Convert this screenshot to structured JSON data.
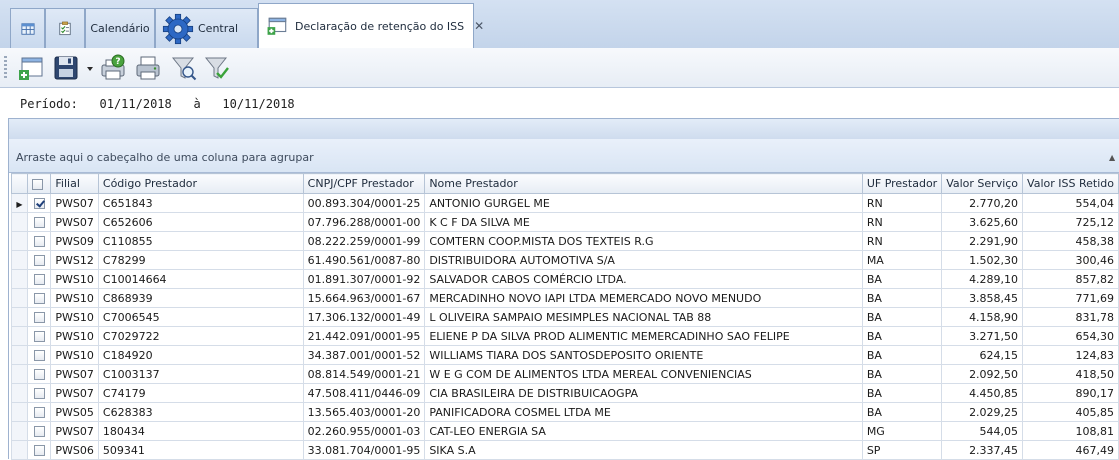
{
  "tabs": [
    {
      "label": "",
      "icon": "grid-icon"
    },
    {
      "label": "",
      "icon": "checklist-icon"
    },
    {
      "label": "Calendário",
      "icon": ""
    },
    {
      "label": "Central",
      "icon": "gear-icon"
    },
    {
      "label": "Declaração de retenção do ISS",
      "icon": "add-document-icon",
      "close": "✕"
    }
  ],
  "toolbar": {
    "icons": [
      "new-document-icon",
      "save-icon",
      "print-preview-icon",
      "print-icon",
      "filter-search-icon",
      "filter-apply-icon"
    ]
  },
  "period": {
    "label": "Período:",
    "start": "01/11/2018",
    "sep": "à",
    "end": "10/11/2018"
  },
  "grid": {
    "group_hint": "Arraste aqui o cabeçalho de uma coluna para agrupar",
    "columns": [
      "Filial",
      "Código Prestador",
      "CNPJ/CPF Prestador",
      "Nome Prestador",
      "UF Prestador",
      "Valor Serviço",
      "Valor ISS Retido"
    ],
    "rows": [
      {
        "filial": "PWS07",
        "codigo": "C651843",
        "cnpj": "00.893.304/0001-25",
        "nome": "ANTONIO GURGEL ME",
        "uf": "RN",
        "valor": "2.770,20",
        "iss": "554,04",
        "checked": true,
        "current": true
      },
      {
        "filial": "PWS07",
        "codigo": "C652606",
        "cnpj": "07.796.288/0001-00",
        "nome": "K C F DA SILVA ME",
        "uf": "RN",
        "valor": "3.625,60",
        "iss": "725,12",
        "checked": false,
        "current": false
      },
      {
        "filial": "PWS09",
        "codigo": "C110855",
        "cnpj": "08.222.259/0001-99",
        "nome": "COMTERN COOP.MISTA DOS TEXTEIS R.G",
        "uf": "RN",
        "valor": "2.291,90",
        "iss": "458,38",
        "checked": false,
        "current": false
      },
      {
        "filial": "PWS12",
        "codigo": "C78299",
        "cnpj": "61.490.561/0087-80",
        "nome": "DISTRIBUIDORA AUTOMOTIVA S/A",
        "uf": "MA",
        "valor": "1.502,30",
        "iss": "300,46",
        "checked": false,
        "current": false
      },
      {
        "filial": "PWS10",
        "codigo": "C10014664",
        "cnpj": "01.891.307/0001-92",
        "nome": "SALVADOR CABOS COMÉRCIO LTDA.",
        "uf": "BA",
        "valor": "4.289,10",
        "iss": "857,82",
        "checked": false,
        "current": false
      },
      {
        "filial": "PWS10",
        "codigo": "C868939",
        "cnpj": "15.664.963/0001-67",
        "nome": "MERCADINHO NOVO IAPI LTDA MEMERCADO NOVO MENUDO",
        "uf": "BA",
        "valor": "3.858,45",
        "iss": "771,69",
        "checked": false,
        "current": false
      },
      {
        "filial": "PWS10",
        "codigo": "C7006545",
        "cnpj": "17.306.132/0001-49",
        "nome": "L OLIVEIRA SAMPAIO MESIMPLES NACIONAL TAB 88",
        "uf": "BA",
        "valor": "4.158,90",
        "iss": "831,78",
        "checked": false,
        "current": false
      },
      {
        "filial": "PWS10",
        "codigo": "C7029722",
        "cnpj": "21.442.091/0001-95",
        "nome": "ELIENE P DA SILVA PROD ALIMENTIC MEMERCADINHO SAO FELIPE",
        "uf": "BA",
        "valor": "3.271,50",
        "iss": "654,30",
        "checked": false,
        "current": false
      },
      {
        "filial": "PWS10",
        "codigo": "C184920",
        "cnpj": "34.387.001/0001-52",
        "nome": "WILLIAMS TIARA DOS SANTOSDEPOSITO ORIENTE",
        "uf": "BA",
        "valor": "624,15",
        "iss": "124,83",
        "checked": false,
        "current": false
      },
      {
        "filial": "PWS07",
        "codigo": "C1003137",
        "cnpj": "08.814.549/0001-21",
        "nome": "W E G COM DE ALIMENTOS LTDA MEREAL CONVENIENCIAS",
        "uf": "BA",
        "valor": "2.092,50",
        "iss": "418,50",
        "checked": false,
        "current": false
      },
      {
        "filial": "PWS07",
        "codigo": "C74179",
        "cnpj": "47.508.411/0446-09",
        "nome": "CIA BRASILEIRA DE DISTRIBUICAOGPA",
        "uf": "BA",
        "valor": "4.450,85",
        "iss": "890,17",
        "checked": false,
        "current": false
      },
      {
        "filial": "PWS05",
        "codigo": "C628383",
        "cnpj": "13.565.403/0001-20",
        "nome": "PANIFICADORA COSMEL LTDA ME",
        "uf": "BA",
        "valor": "2.029,25",
        "iss": "405,85",
        "checked": false,
        "current": false
      },
      {
        "filial": "PWS07",
        "codigo": "180434",
        "cnpj": "02.260.955/0001-03",
        "nome": "CAT-LEO ENERGIA SA",
        "uf": "MG",
        "valor": "544,05",
        "iss": "108,81",
        "checked": false,
        "current": false
      },
      {
        "filial": "PWS06",
        "codigo": "509341",
        "cnpj": "33.081.704/0001-95",
        "nome": "SIKA S.A",
        "uf": "SP",
        "valor": "2.337,45",
        "iss": "467,49",
        "checked": false,
        "current": false
      }
    ]
  }
}
